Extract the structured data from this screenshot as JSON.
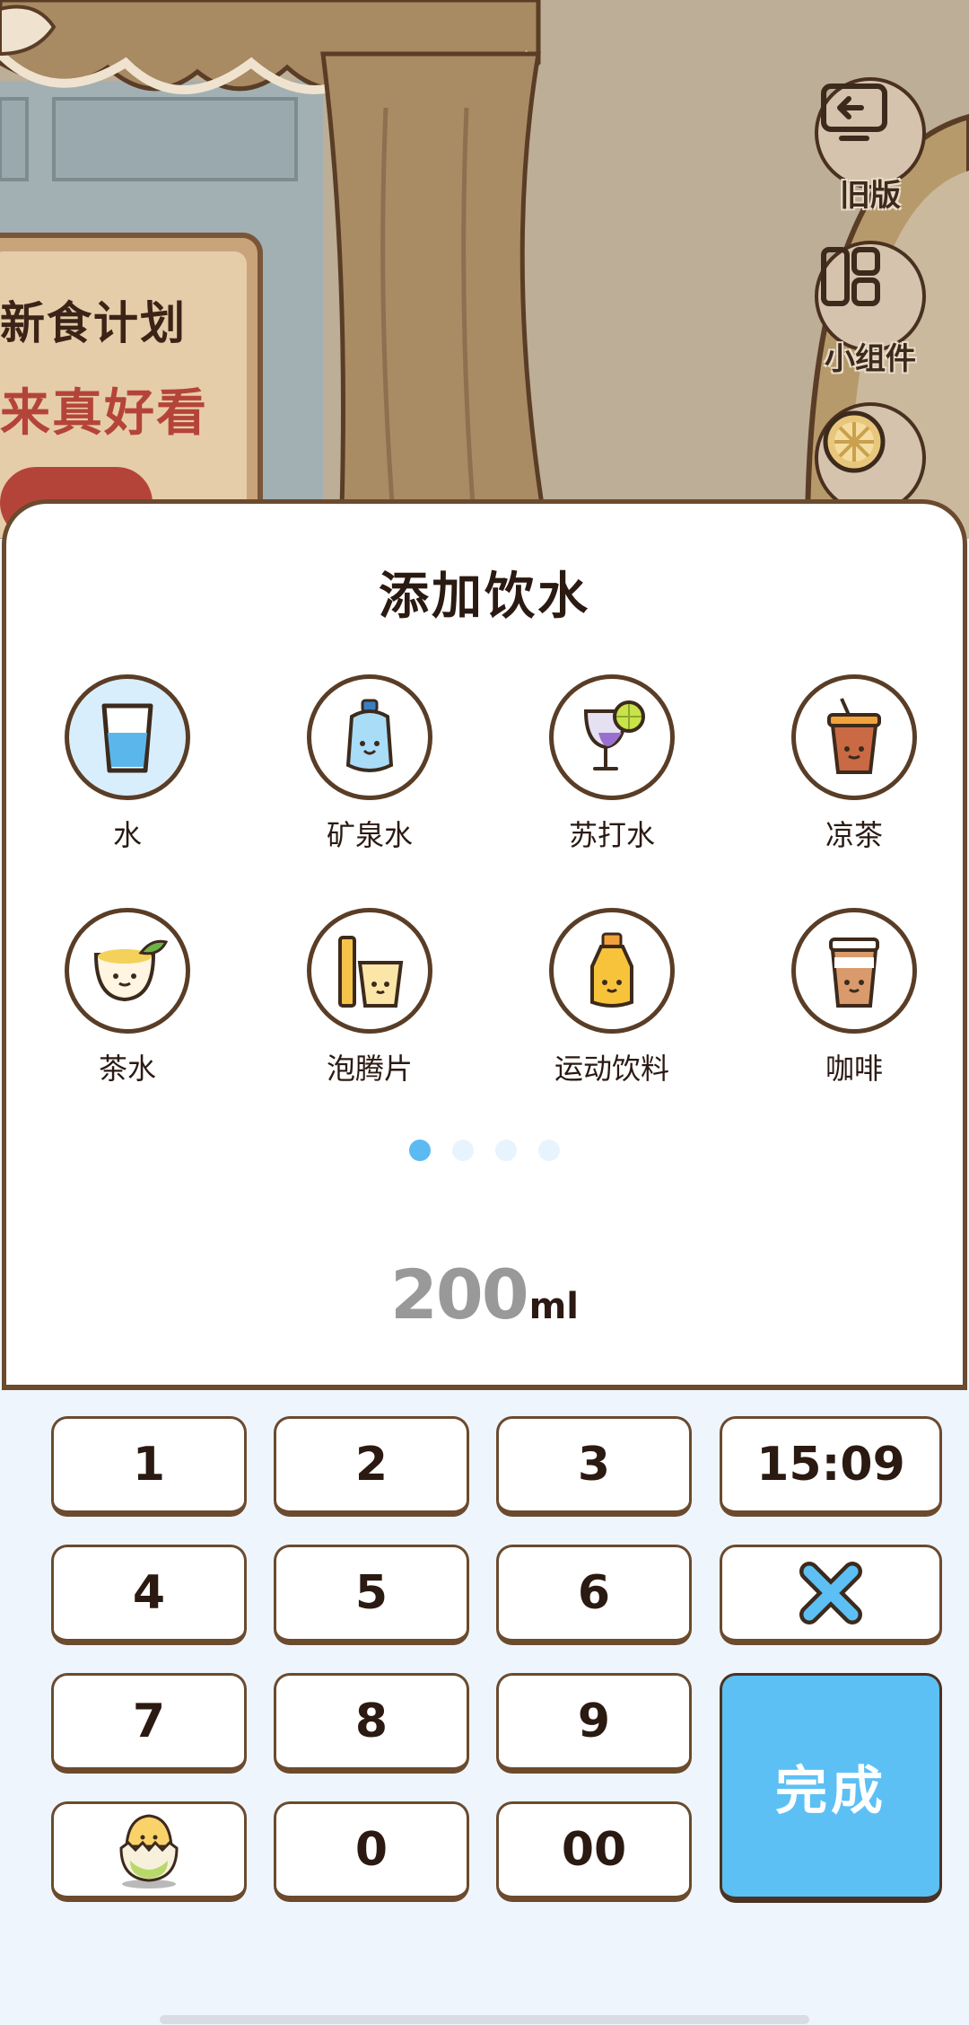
{
  "background": {
    "plan_line1": "新食计划",
    "plan_line2": "来真好看",
    "side_buttons": [
      {
        "label": "旧版",
        "icon": "back-screen-icon"
      },
      {
        "label": "小组件",
        "icon": "widget-grid-icon"
      },
      {
        "label": "",
        "icon": "orange-slice-icon"
      }
    ]
  },
  "card": {
    "title": "添加饮水",
    "drinks": [
      {
        "name": "水",
        "icon": "water-glass-icon",
        "selected": true
      },
      {
        "name": "矿泉水",
        "icon": "mineral-water-bottle-icon",
        "selected": false
      },
      {
        "name": "苏打水",
        "icon": "soda-water-glass-icon",
        "selected": false
      },
      {
        "name": "凉茶",
        "icon": "herbal-tea-cup-icon",
        "selected": false
      },
      {
        "name": "茶水",
        "icon": "tea-bowl-icon",
        "selected": false
      },
      {
        "name": "泡腾片",
        "icon": "effervescent-tablet-icon",
        "selected": false
      },
      {
        "name": "运动饮料",
        "icon": "sports-drink-bottle-icon",
        "selected": false
      },
      {
        "name": "咖啡",
        "icon": "coffee-cup-icon",
        "selected": false
      }
    ],
    "page_dots": {
      "count": 4,
      "active": 1
    },
    "amount": {
      "value": "200",
      "unit": "ml"
    }
  },
  "keypad": {
    "keys": {
      "k1": "1",
      "k2": "2",
      "k3": "3",
      "time": "15:09",
      "k4": "4",
      "k5": "5",
      "k6": "6",
      "k7": "7",
      "k8": "8",
      "k9": "9",
      "k0": "0",
      "k00": "00",
      "done": "完成"
    },
    "delete_icon": "close-x-icon",
    "mascot_icon": "chick-mascot-icon"
  },
  "colors": {
    "accent_blue": "#5cc0f5",
    "border_brown": "#6b4a2e",
    "text_dark": "#2b1a12",
    "keypad_bg": "#eef5fc"
  }
}
